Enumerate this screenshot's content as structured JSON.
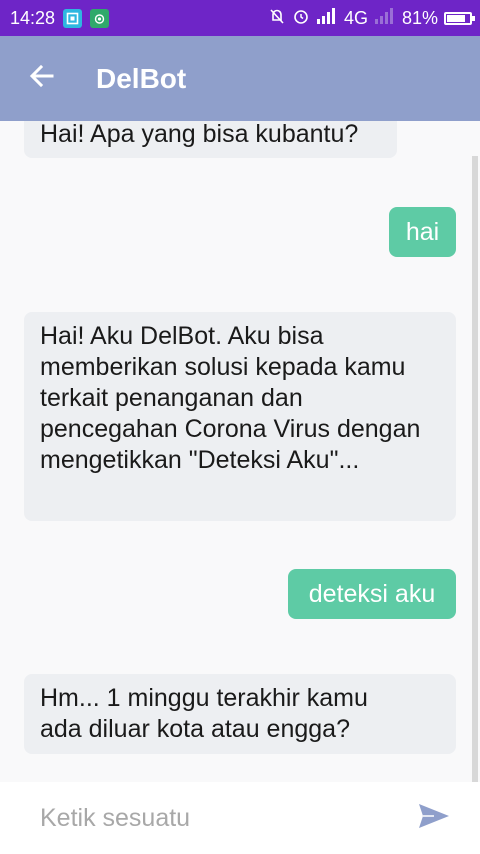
{
  "status_bar": {
    "time": "14:28",
    "network": "4G",
    "battery": "81%",
    "battery_level": 0.81
  },
  "header": {
    "title": "DelBot"
  },
  "messages": [
    {
      "sender": "bot",
      "text": "Hai! Apa yang bisa kubantu?"
    },
    {
      "sender": "user",
      "text": "hai"
    },
    {
      "sender": "bot",
      "text": "Hai! Aku DelBot. Aku bisa memberikan solusi kepada kamu terkait penanganan dan pencegahan Corona Virus dengan mengetikkan \"Deteksi Aku\"..."
    },
    {
      "sender": "user",
      "text": "deteksi aku"
    },
    {
      "sender": "bot",
      "text": "Hm... 1 minggu terakhir kamu ada diluar kota atau engga?"
    }
  ],
  "composer": {
    "placeholder": "Ketik sesuatu",
    "value": ""
  },
  "colors": {
    "status_bar": "#6e25c7",
    "app_bar": "#8f9fcb",
    "user_bubble": "#5ecba5",
    "bot_bubble": "#edeff2",
    "send_icon": "#8f9fcb"
  }
}
